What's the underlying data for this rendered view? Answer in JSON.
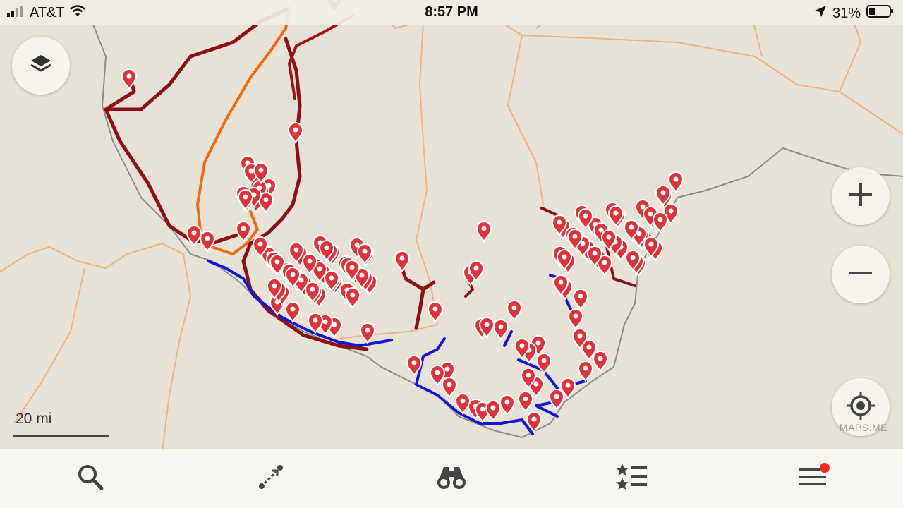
{
  "status_bar": {
    "carrier": "AT&T",
    "time": "8:57 PM",
    "battery_percent": "31%"
  },
  "map": {
    "scale_label": "20 mi",
    "attribution": "MAPS.ME",
    "colors": {
      "background": "#e6e3d6",
      "road": "#f2b27e",
      "border": "#8c8c8c",
      "track_dark_red": "#8e0f14",
      "track_red": "#b01a1a",
      "track_orange": "#f26a12",
      "track_blue": "#1414d8",
      "pin": "#e0323a"
    }
  },
  "controls": {
    "layers": "layers-icon",
    "zoom_in": "plus-icon",
    "zoom_out": "minus-icon",
    "my_location": "crosshair-icon"
  },
  "bottom_nav": {
    "items": [
      "search-icon",
      "route-icon",
      "binoculars-icon",
      "bookmarks-icon",
      "menu-icon"
    ],
    "menu_badge_color": "#f02b1f"
  }
}
